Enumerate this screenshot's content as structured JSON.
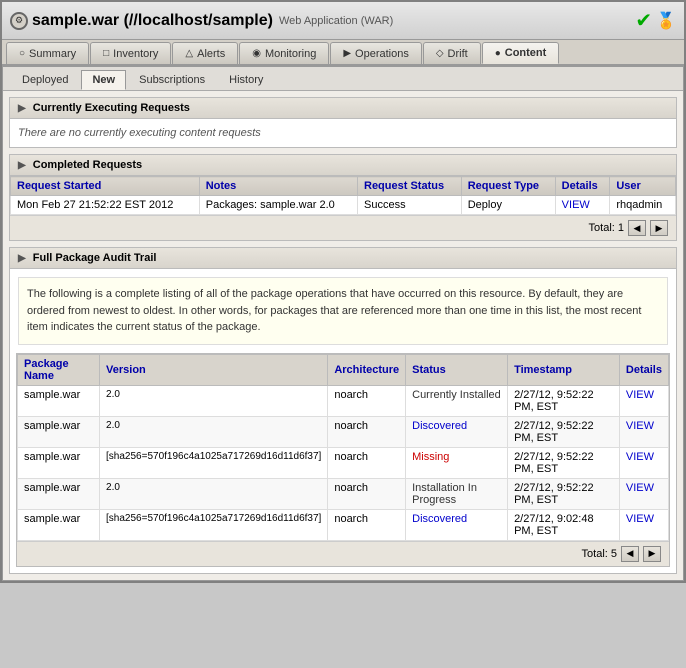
{
  "window": {
    "title": "sample.war (//localhost/sample)",
    "subtitle": "Web Application (WAR)"
  },
  "nav_tabs": [
    {
      "id": "summary",
      "label": "Summary",
      "icon": "○"
    },
    {
      "id": "inventory",
      "label": "Inventory",
      "icon": "□"
    },
    {
      "id": "alerts",
      "label": "Alerts",
      "icon": "△"
    },
    {
      "id": "monitoring",
      "label": "Monitoring",
      "icon": "◉"
    },
    {
      "id": "operations",
      "label": "Operations",
      "icon": "▶"
    },
    {
      "id": "drift",
      "label": "Drift",
      "icon": "◇"
    },
    {
      "id": "content",
      "label": "Content",
      "icon": "●",
      "active": true
    }
  ],
  "sub_tabs": [
    {
      "label": "Deployed"
    },
    {
      "label": "New",
      "active": true
    },
    {
      "label": "Subscriptions"
    },
    {
      "label": "History"
    }
  ],
  "executing_section": {
    "title": "Currently Executing Requests",
    "empty_text": "There are no currently executing content requests"
  },
  "completed_section": {
    "title": "Completed Requests",
    "columns": [
      "Request Started",
      "Notes",
      "Request Status",
      "Request Type",
      "Details",
      "User"
    ],
    "rows": [
      {
        "request_started": "Mon Feb 27 21:52:22 EST 2012",
        "notes": "Packages: sample.war 2.0",
        "request_status": "Success",
        "request_type": "Deploy",
        "details": "VIEW",
        "user": "rhqadmin"
      }
    ],
    "total": "Total: 1"
  },
  "audit_section": {
    "title": "Full Package Audit Trail",
    "description": "The following is a complete listing of all of the package operations that have occurred on this resource. By default, they are ordered from newest to oldest. In other words, for packages that are referenced more than one time in this list, the most recent item indicates the current status of the package.",
    "columns": [
      "Package Name",
      "Version",
      "Architecture",
      "Status",
      "Timestamp",
      "Details"
    ],
    "rows": [
      {
        "name": "sample.war",
        "version": "2.0",
        "architecture": "noarch",
        "status": "Currently Installed",
        "status_class": "status-installed",
        "timestamp": "2/27/12, 9:52:22 PM, EST",
        "details": "VIEW"
      },
      {
        "name": "sample.war",
        "version": "2.0",
        "architecture": "noarch",
        "status": "Discovered",
        "status_class": "status-discovered",
        "timestamp": "2/27/12, 9:52:22 PM, EST",
        "details": "VIEW"
      },
      {
        "name": "sample.war",
        "version": "[sha256=570f196c4a1025a717269d16d11d6f37]",
        "architecture": "noarch",
        "status": "Missing",
        "status_class": "status-missing",
        "timestamp": "2/27/12, 9:52:22 PM, EST",
        "details": "VIEW"
      },
      {
        "name": "sample.war",
        "version": "2.0",
        "architecture": "noarch",
        "status": "Installation In Progress",
        "status_class": "status-inprogress",
        "timestamp": "2/27/12, 9:52:22 PM, EST",
        "details": "VIEW"
      },
      {
        "name": "sample.war",
        "version": "[sha256=570f196c4a1025a717269d16d11d6f37]",
        "architecture": "noarch",
        "status": "Discovered",
        "status_class": "status-discovered",
        "timestamp": "2/27/12, 9:02:48 PM, EST",
        "details": "VIEW"
      }
    ],
    "total": "Total: 5"
  }
}
